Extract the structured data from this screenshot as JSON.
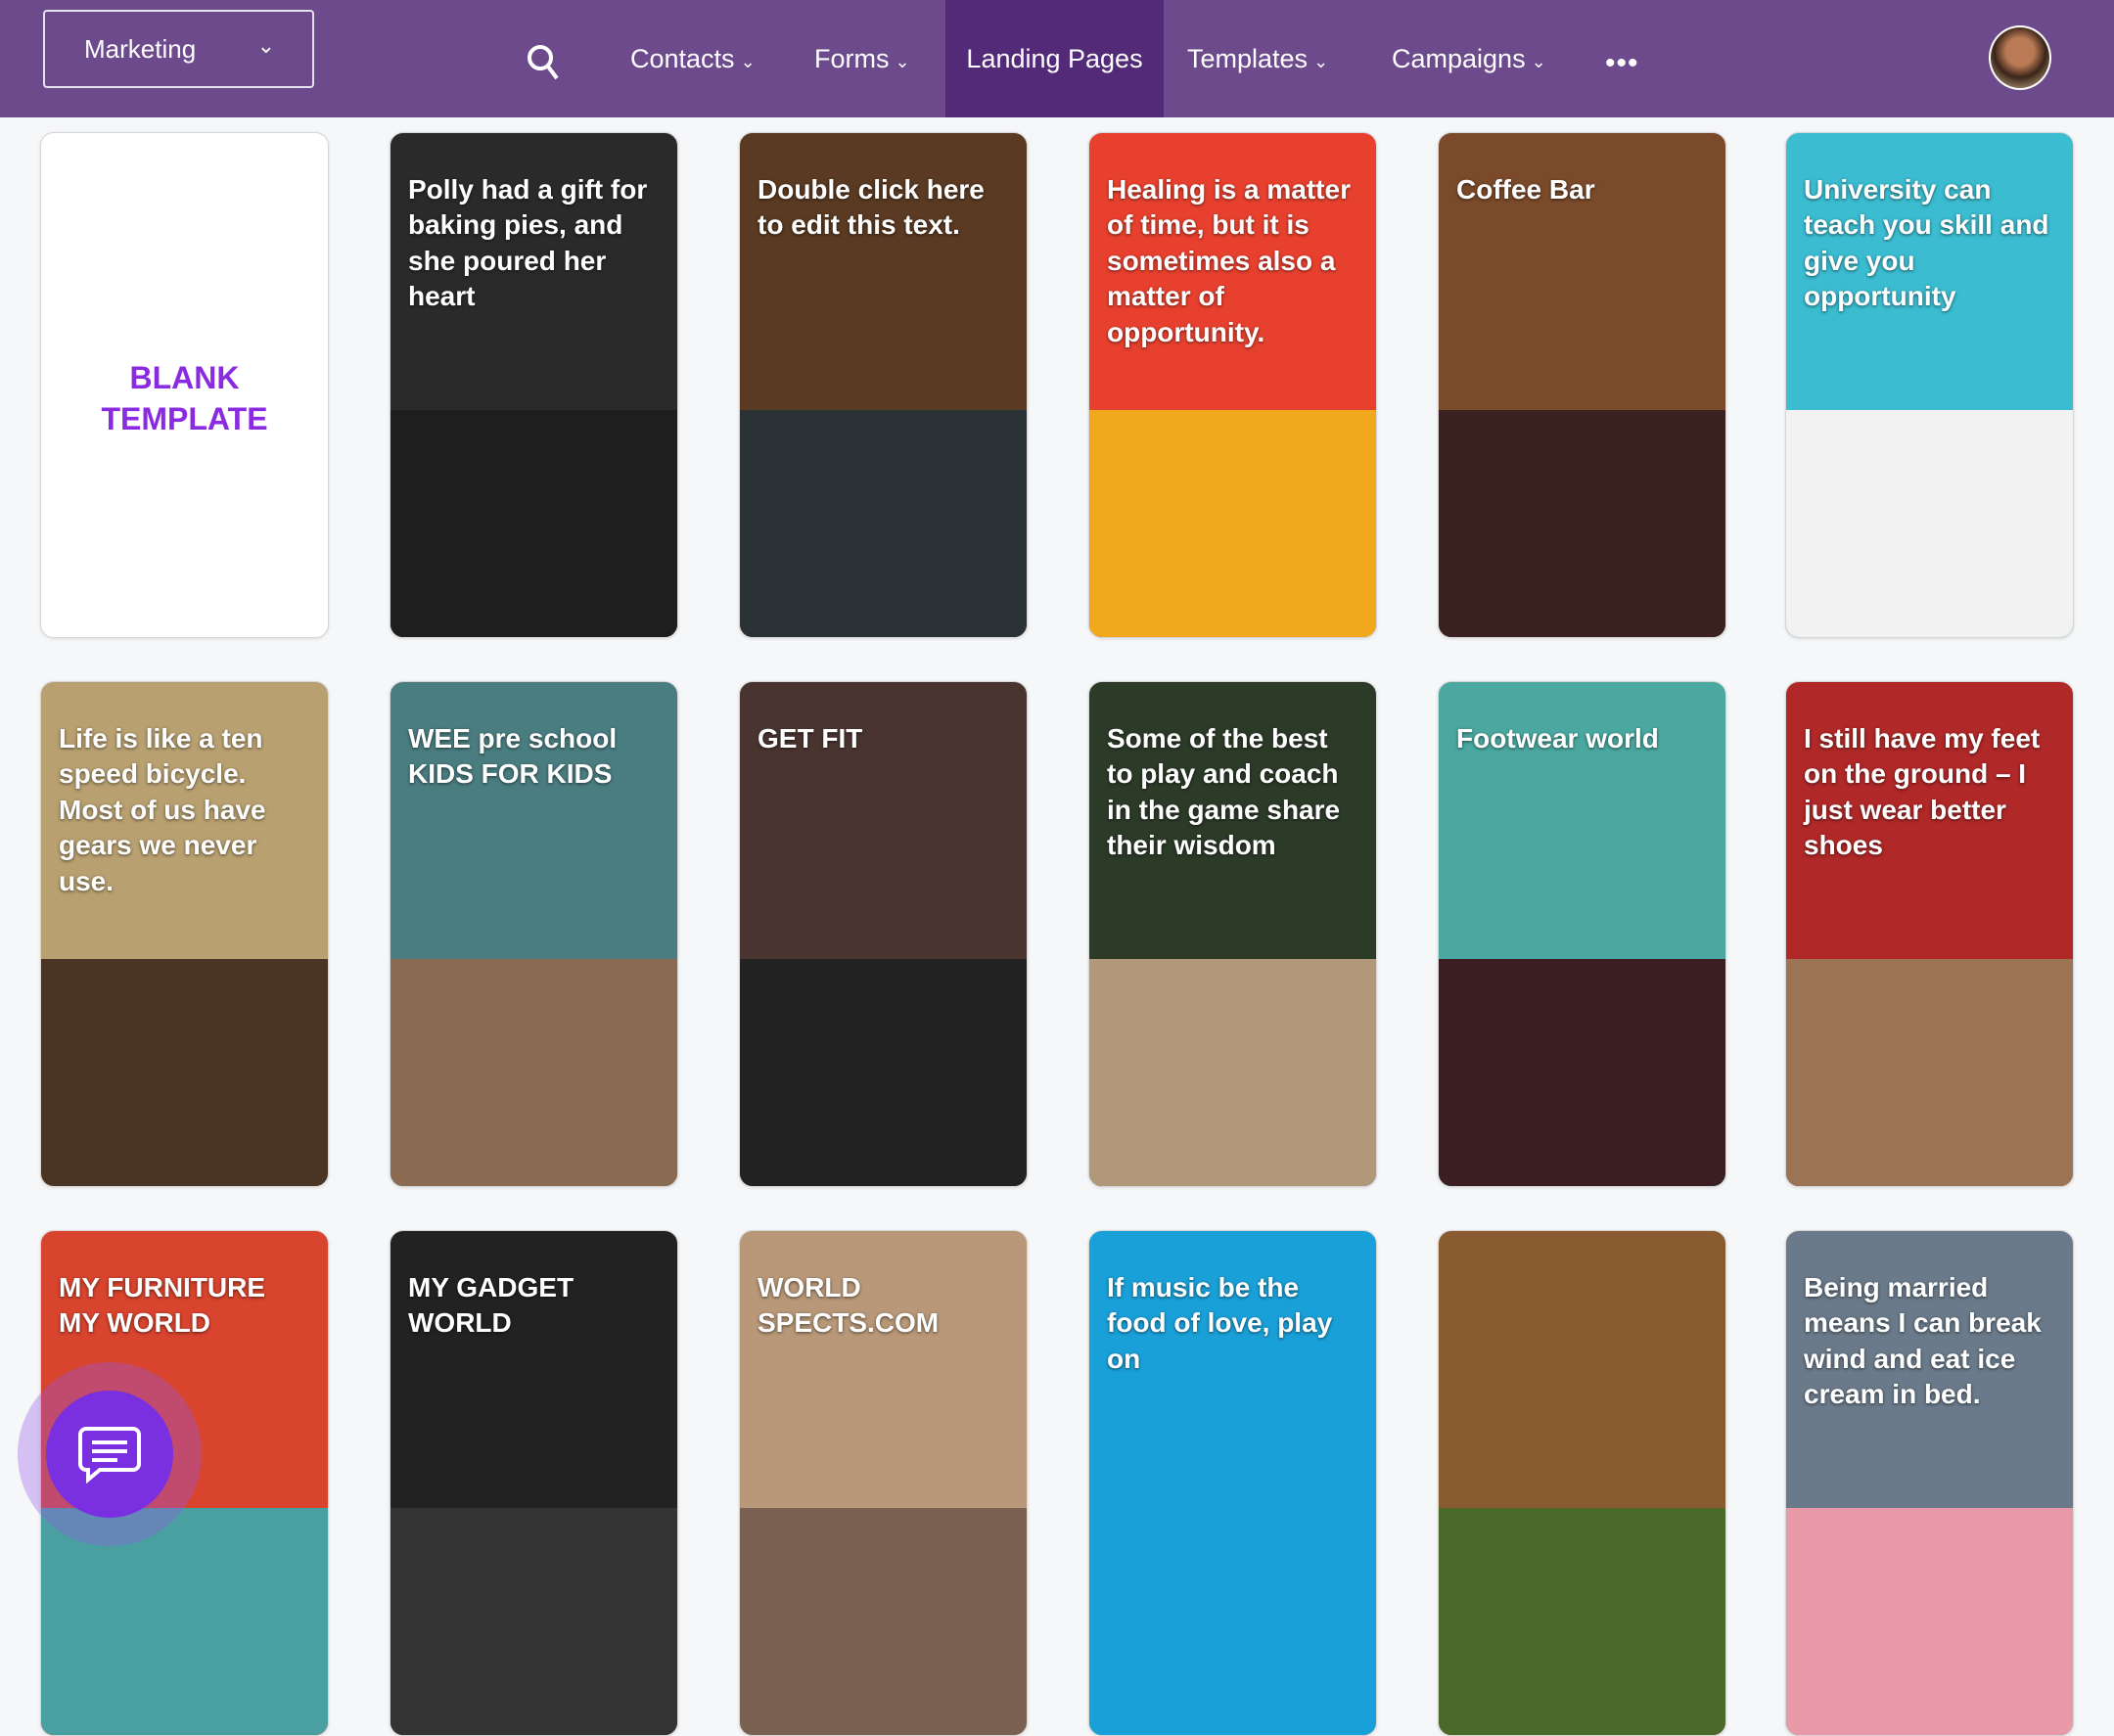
{
  "nav": {
    "workspace": "Marketing",
    "items": [
      {
        "label": "Contacts",
        "dropdown": true
      },
      {
        "label": "Forms",
        "dropdown": true
      },
      {
        "label": "Landing Pages",
        "dropdown": false,
        "active": true
      },
      {
        "label": "Templates",
        "dropdown": true
      },
      {
        "label": "Campaigns",
        "dropdown": true
      }
    ],
    "more": "•••"
  },
  "colors": {
    "nav": "#6c4a8c",
    "active": "#532a78",
    "chat": "#7a2fe0"
  },
  "templates": [
    {
      "title": "BLANK TEMPLATE",
      "bg": "#ffffff",
      "bottom": "#ffffff"
    },
    {
      "title": "Polly had a gift for baking pies, and she poured her heart",
      "bg": "#2a2a2a",
      "bottom": "#1e1e1e"
    },
    {
      "title": "Double click here to edit this text.",
      "bg": "#5a3a22",
      "bottom": "#2a3236"
    },
    {
      "title": "Healing is a matter of time, but it is sometimes also a matter of opportunity.",
      "bg": "#e8402e",
      "bottom": "#f2a81c"
    },
    {
      "title": "Coffee Bar",
      "bg": "#7a4a2a",
      "bottom": "#3b2220"
    },
    {
      "title": "University can teach you skill and give you opportunity",
      "bg": "#3bbcd0",
      "bottom": "#f2f2f2"
    },
    {
      "title": "Life is like a ten speed bicycle. Most of us have gears we never use.",
      "bg": "#b8a070",
      "bottom": "#4a3424"
    },
    {
      "title": "WEE pre school KIDS FOR KIDS",
      "bg": "#4a7d80",
      "bottom": "#8a6a50"
    },
    {
      "title": "GET FIT",
      "bg": "#4a3430",
      "bottom": "#222"
    },
    {
      "title": "Some of the best to play and coach in the game share their wisdom",
      "bg": "#2c3a28",
      "bottom": "#b09878"
    },
    {
      "title": "Footwear world",
      "bg": "#4aa8a0",
      "bottom": "#3a1e22"
    },
    {
      "title": "I still have my feet on the ground – I just wear better shoes",
      "bg": "#b02828",
      "bottom": "#9a7454"
    },
    {
      "title": "MY FURNITURE MY WORLD",
      "bg": "#d8442e",
      "bottom": "#4aa0a0"
    },
    {
      "title": "MY GADGET WORLD",
      "bg": "#222222",
      "bottom": "#333"
    },
    {
      "title": "WORLD SPECTS.COM",
      "bg": "#b89878",
      "bottom": "#7a6050"
    },
    {
      "title": "If music be the food of love, play on",
      "bg": "#1aa0d8",
      "bottom": "#1aa0d8"
    },
    {
      "title": "",
      "bg": "#8a5a30",
      "bottom": "#4a6a2a"
    },
    {
      "title": "Being married means I can break wind and eat ice cream in bed.",
      "bg": "#6a7a8a",
      "bottom": "#e89aa8"
    }
  ]
}
